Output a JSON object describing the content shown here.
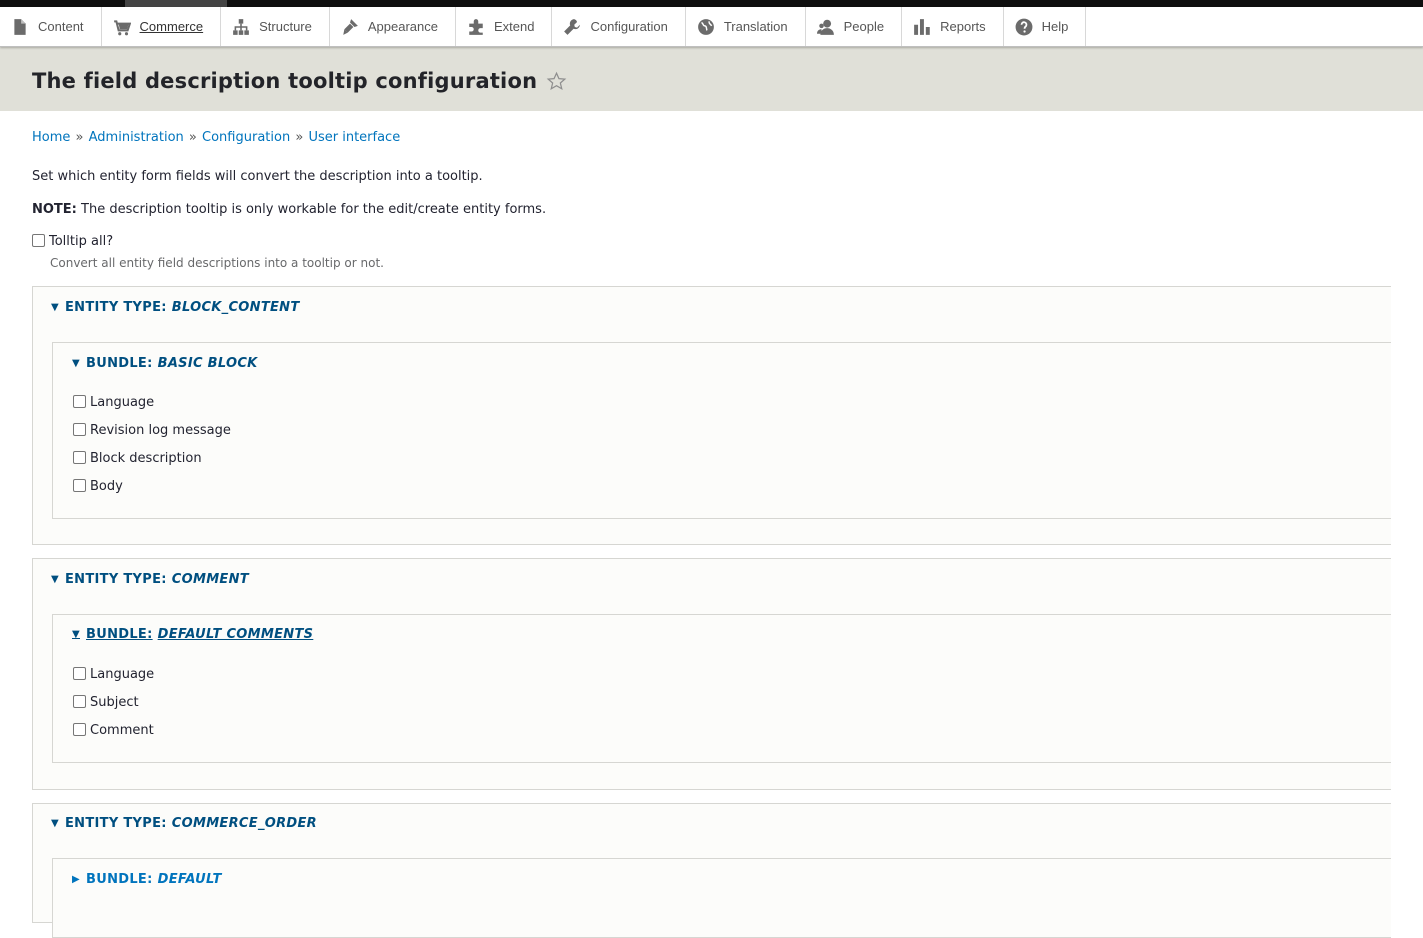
{
  "toolbar": {
    "items": [
      {
        "label": "Content",
        "icon": "file-icon"
      },
      {
        "label": "Commerce",
        "icon": "cart-icon"
      },
      {
        "label": "Structure",
        "icon": "sitemap-icon"
      },
      {
        "label": "Appearance",
        "icon": "paintbrush-icon"
      },
      {
        "label": "Extend",
        "icon": "puzzle-icon"
      },
      {
        "label": "Configuration",
        "icon": "wrench-icon"
      },
      {
        "label": "Translation",
        "icon": "globe-icon"
      },
      {
        "label": "People",
        "icon": "person-icon"
      },
      {
        "label": "Reports",
        "icon": "bar-chart-icon"
      },
      {
        "label": "Help",
        "icon": "question-icon"
      }
    ],
    "active": "Commerce"
  },
  "page": {
    "title": "The field description tooltip configuration",
    "breadcrumb": [
      "Home",
      "Administration",
      "Configuration",
      "User interface"
    ],
    "breadcrumb_sep": "»",
    "intro": "Set which entity form fields will convert the description into a tooltip.",
    "note_label": "NOTE:",
    "note_text": " The description tooltip is only workable for the edit/create entity forms."
  },
  "tooltip_all": {
    "label": "Tolltip all?",
    "description": "Convert all entity field descriptions into a tooltip or not."
  },
  "entity_types": [
    {
      "prefix": "ENTITY TYPE:",
      "name": "BLOCK_CONTENT",
      "bundle": {
        "prefix": "BUNDLE:",
        "name": "BASIC BLOCK",
        "fields": [
          "Language",
          "Revision log message",
          "Block description",
          "Body"
        ]
      }
    },
    {
      "prefix": "ENTITY TYPE:",
      "name": "COMMENT",
      "bundle": {
        "prefix": "BUNDLE:",
        "name": "DEFAULT COMMENTS",
        "fields": [
          "Language",
          "Subject",
          "Comment"
        ]
      }
    },
    {
      "prefix": "ENTITY TYPE:",
      "name": "COMMERCE_ORDER",
      "bundle": {
        "prefix": "BUNDLE:",
        "name": "DEFAULT"
      }
    }
  ],
  "colors": {
    "link": "#0074bd",
    "summary": "#004f80",
    "header_bg": "#e0e0d8",
    "topbar": "#0f0f0f"
  }
}
